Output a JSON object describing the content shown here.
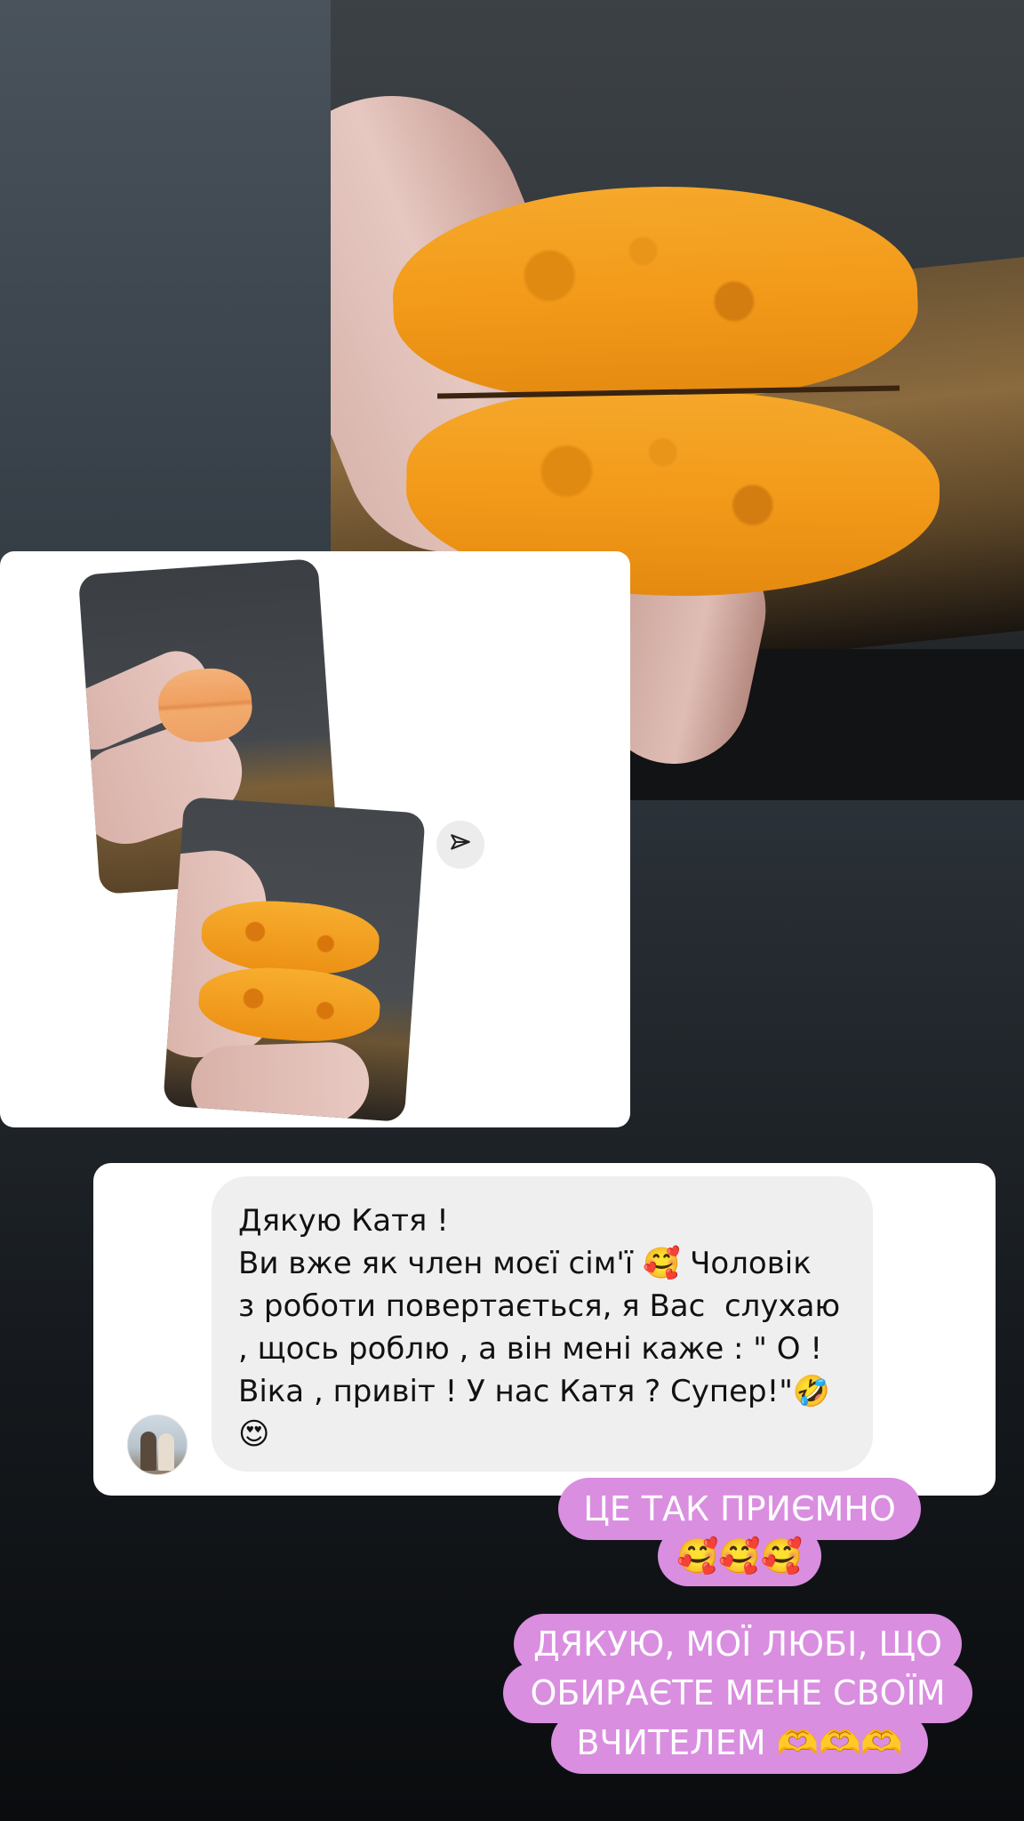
{
  "comment": {
    "lines": [
      "Дякую Катя !",
      "Ви вже як член моєї сім'ї 🥰 Чоловік",
      "з роботи повертається, я Вас  слухаю",
      ", щось роблю , а він мені каже : \" О !",
      "Віка , привіт ! У нас Катя ? Супер!\"🤣",
      "😍"
    ]
  },
  "stickers": {
    "reply_1": [
      "ЦЕ ТАК ПРИЄМНО",
      "🥰🥰🥰"
    ],
    "reply_2": [
      "ДЯКУЮ, МОЇ ЛЮБІ, ЩО",
      "ОБИРАЄТЕ МЕНЕ СВОЇМ",
      "ВЧИТЕЛЕМ 🫶🫶🫶"
    ]
  },
  "icons": {
    "send": "paper-plane-icon"
  },
  "colors": {
    "sticker_bg": "#d98ee0",
    "sticker_text": "#ffffff",
    "bubble_bg": "#efefef",
    "card_bg": "#ffffff"
  }
}
